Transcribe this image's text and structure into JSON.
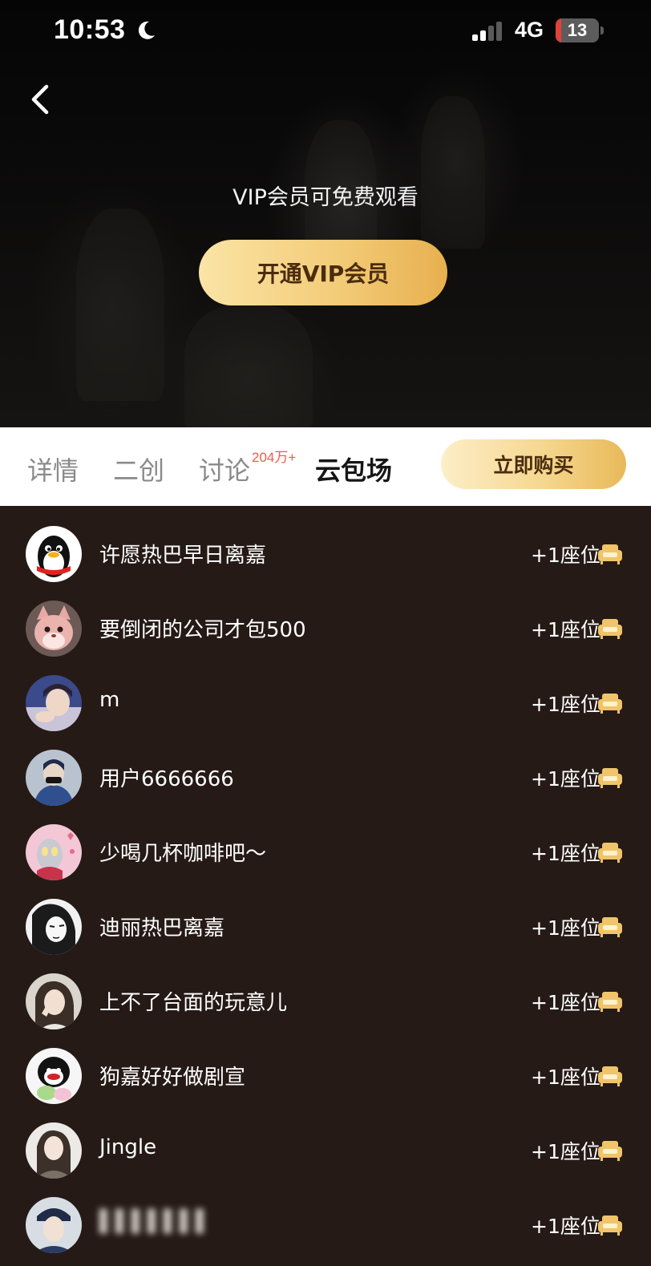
{
  "status_bar": {
    "time": "10:53",
    "network": "4G",
    "battery": "13",
    "battery_level_percent": 13
  },
  "hero": {
    "vip_tip": "VIP会员可免费观看",
    "vip_button_label": "开通VIP会员"
  },
  "tabs": {
    "items": [
      {
        "label": "详情"
      },
      {
        "label": "二创"
      },
      {
        "label": "讨论",
        "badge": "204万+"
      },
      {
        "label": "云包场"
      }
    ],
    "active_tab": "云包场",
    "buy_button_label": "立即购买"
  },
  "seat_list": {
    "items": [
      {
        "name": "许愿热巴早日离嘉",
        "seat": "+1座位",
        "avatar": "qq-penguin-avatar"
      },
      {
        "name": "要倒闭的公司才包500",
        "seat": "+1座位",
        "avatar": "cartoon-fox-avatar"
      },
      {
        "name": "m",
        "seat": "+1座位",
        "avatar": "person-photo-avatar"
      },
      {
        "name": "用户6666666",
        "seat": "+1座位",
        "avatar": "person-photo-avatar"
      },
      {
        "name": "少喝几杯咖啡吧～",
        "seat": "+1座位",
        "avatar": "cartoon-hero-avatar"
      },
      {
        "name": "迪丽热巴离嘉",
        "seat": "+1座位",
        "avatar": "manga-avatar"
      },
      {
        "name": "上不了台面的玩意儿",
        "seat": "+1座位",
        "avatar": "person-photo-avatar"
      },
      {
        "name": "狗嘉好好做剧宣",
        "seat": "+1座位",
        "avatar": "penguin-plush-avatar"
      },
      {
        "name": "Jingle",
        "seat": "+1座位",
        "avatar": "person-photo-avatar"
      },
      {
        "name": "",
        "seat": "+1座位",
        "avatar": "person-photo-avatar",
        "name_obscured": true
      }
    ]
  },
  "colors": {
    "list_background": "#251a16",
    "gold_accent": "#f3cc79",
    "badge_red": "#ef5a4b",
    "button_text": "#4b2c0d"
  }
}
